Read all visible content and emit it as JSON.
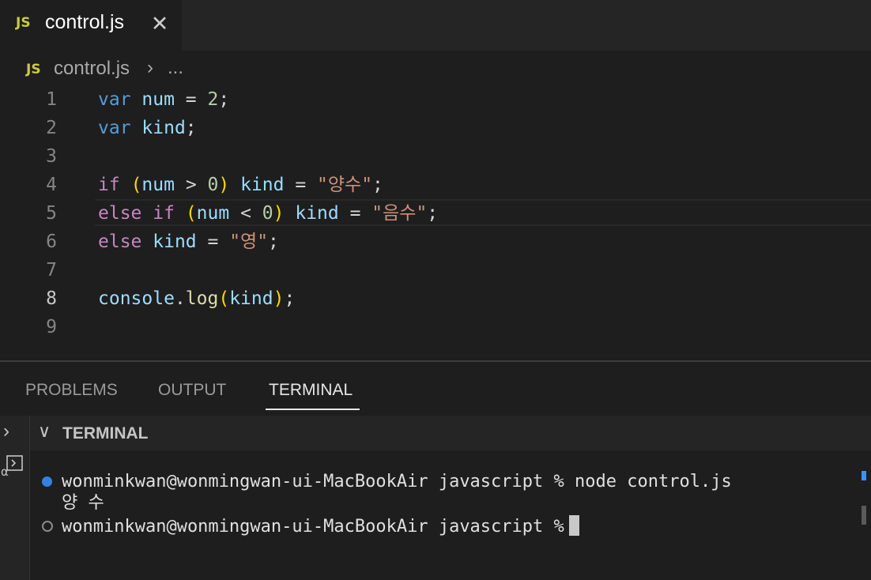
{
  "editor_tab": {
    "icon": "JS",
    "title": "control.js",
    "close_glyph": "✕"
  },
  "breadcrumb": {
    "icon": "JS",
    "file": "control.js",
    "separator": "›",
    "more": "..."
  },
  "code": {
    "current_line": 8,
    "line_numbers": [
      "1",
      "2",
      "3",
      "4",
      "5",
      "6",
      "7",
      "8",
      "9"
    ],
    "lines": [
      [
        {
          "t": "var",
          "c": "kw"
        },
        {
          "t": " "
        },
        {
          "t": "num",
          "c": "var"
        },
        {
          "t": " = "
        },
        {
          "t": "2",
          "c": "num"
        },
        {
          "t": ";"
        }
      ],
      [
        {
          "t": "var",
          "c": "kw"
        },
        {
          "t": " "
        },
        {
          "t": "kind",
          "c": "var"
        },
        {
          "t": ";"
        }
      ],
      [],
      [
        {
          "t": "if",
          "c": "ctl"
        },
        {
          "t": " "
        },
        {
          "t": "(",
          "c": "br"
        },
        {
          "t": "num",
          "c": "var"
        },
        {
          "t": " > "
        },
        {
          "t": "0",
          "c": "num"
        },
        {
          "t": ")",
          "c": "br"
        },
        {
          "t": " "
        },
        {
          "t": "kind",
          "c": "var"
        },
        {
          "t": " = "
        },
        {
          "t": "\"양수\"",
          "c": "str"
        },
        {
          "t": ";"
        }
      ],
      [
        {
          "t": "else",
          "c": "ctl"
        },
        {
          "t": " "
        },
        {
          "t": "if",
          "c": "ctl"
        },
        {
          "t": " "
        },
        {
          "t": "(",
          "c": "br"
        },
        {
          "t": "num",
          "c": "var"
        },
        {
          "t": " < "
        },
        {
          "t": "0",
          "c": "num"
        },
        {
          "t": ")",
          "c": "br"
        },
        {
          "t": " "
        },
        {
          "t": "kind",
          "c": "var"
        },
        {
          "t": " = "
        },
        {
          "t": "\"음수\"",
          "c": "str"
        },
        {
          "t": ";"
        }
      ],
      [
        {
          "t": "else",
          "c": "ctl"
        },
        {
          "t": " "
        },
        {
          "t": "kind",
          "c": "var"
        },
        {
          "t": " = "
        },
        {
          "t": "\"영\"",
          "c": "str"
        },
        {
          "t": ";"
        }
      ],
      [],
      [
        {
          "t": "console",
          "c": "var"
        },
        {
          "t": "."
        },
        {
          "t": "log",
          "c": "fn"
        },
        {
          "t": "(",
          "c": "br"
        },
        {
          "t": "kind",
          "c": "var"
        },
        {
          "t": ")",
          "c": "br"
        },
        {
          "t": ";"
        }
      ],
      []
    ]
  },
  "panel": {
    "tabs": [
      "PROBLEMS",
      "OUTPUT",
      "TERMINAL"
    ],
    "active_tab": "TERMINAL",
    "terminal_header": "TERMINAL"
  },
  "terminal": {
    "line1": "wonminkwan@wonmingwan-ui-MacBookAir javascript % node control.js",
    "output": "양 수",
    "line3": "wonminkwan@wonmingwan-ui-MacBookAir javascript %"
  },
  "colors": {
    "keyword": "#569cd6",
    "control": "#c586c0",
    "variable": "#9cdcfe",
    "number": "#b5cea8",
    "string": "#ce9178",
    "function": "#dcdcaa",
    "bracket": "#ffd700",
    "js_badge": "#cbcb41",
    "accent_blue": "#3794ff"
  }
}
